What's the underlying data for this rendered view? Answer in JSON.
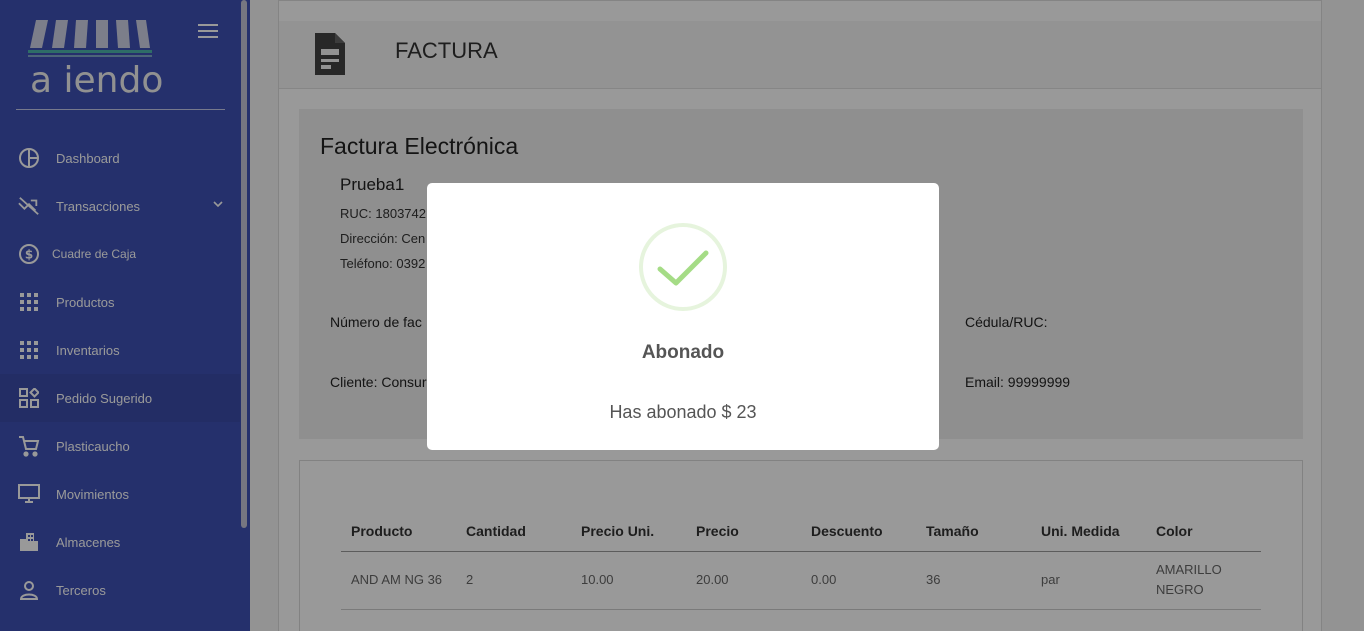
{
  "sidebar": {
    "logo_text": "a iendo",
    "items": [
      {
        "label": "Dashboard",
        "icon": "dashboard-icon"
      },
      {
        "label": "Transacciones",
        "icon": "transactions-icon"
      },
      {
        "label": "Cuadre de Caja",
        "icon": "dollar-icon"
      },
      {
        "label": "Productos",
        "icon": "grid-icon"
      },
      {
        "label": "Inventarios",
        "icon": "grid-icon"
      },
      {
        "label": "Pedido Sugerido",
        "icon": "widgets-icon"
      },
      {
        "label": "Plasticaucho",
        "icon": "cart-icon"
      },
      {
        "label": "Movimientos",
        "icon": "monitor-icon"
      },
      {
        "label": "Almacenes",
        "icon": "building-icon"
      },
      {
        "label": "Terceros",
        "icon": "person-icon"
      }
    ],
    "active_item": "Pedido Sugerido"
  },
  "header": {
    "title": "FACTURA"
  },
  "invoice": {
    "title": "Factura Electrónica",
    "company": "Prueba1",
    "ruc": "RUC: 1803742",
    "address": "Dirección: Cen",
    "phone": "Teléfono: 0392",
    "invoice_number_label": "Número de fac",
    "id_label": "Cédula/RUC:",
    "client": "Cliente: Consur",
    "email": "Email: 99999999"
  },
  "table": {
    "headers": [
      "Producto",
      "Cantidad",
      "Precio Uni.",
      "Precio",
      "Descuento",
      "Tamaño",
      "Uni. Medida",
      "Color"
    ],
    "rows": [
      [
        "AND AM NG 36",
        "2",
        "10.00",
        "20.00",
        "0.00",
        "36",
        "par",
        "AMARILLO NEGRO"
      ]
    ]
  },
  "modal": {
    "title": "Abonado",
    "text": "Has abonado $ 23"
  },
  "colors": {
    "sidebar": "#3f51b5",
    "success": "#a5dc86"
  }
}
